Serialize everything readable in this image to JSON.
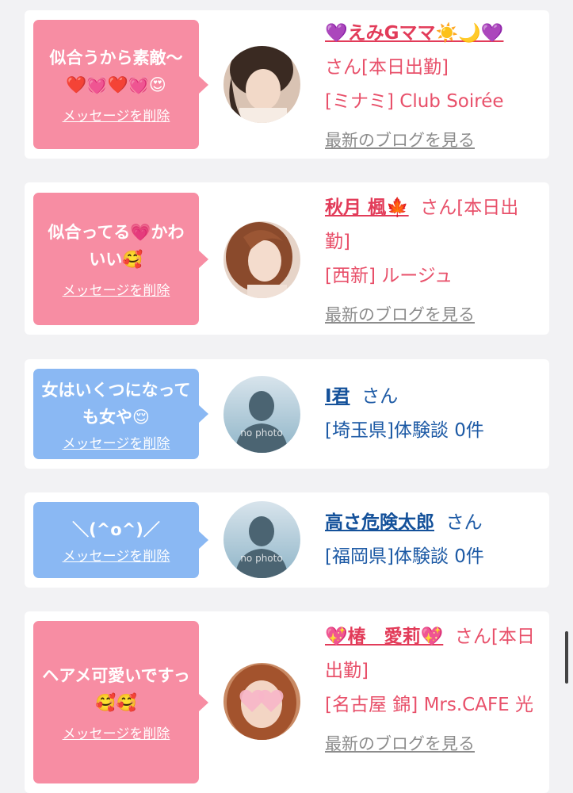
{
  "delete_label": "メッセージを削除",
  "blog_label": "最新のブログを見る",
  "no_photo": "no photo",
  "colors": {
    "pink_bubble": "#f78da3",
    "blue_bubble": "#8ab8f3",
    "pink_text": "#e8506a",
    "blue_text": "#1d5aa5"
  },
  "items": [
    {
      "message": "似合うから素敵〜❤️💓❤️💓😍",
      "name": "💜えみGママ☀️🌙💜",
      "suffix": "さん[本日出勤]",
      "shop": "[ミナミ] Club Soirée",
      "has_blog": true,
      "avatar": "photo-woman-1"
    },
    {
      "message": "似合ってる💗かわいい🥰",
      "name": "秋月 楓🍁",
      "suffix": "さん[本日出勤]",
      "shop": "[西新] ルージュ",
      "has_blog": true,
      "avatar": "photo-woman-2"
    },
    {
      "message": "女はいくつになっても女や😌",
      "name": "I君",
      "suffix": "さん",
      "shop": "[埼玉県]体験談 0件",
      "has_blog": false,
      "avatar": "no-photo"
    },
    {
      "message": "＼(^o^)／",
      "name": "高さ危険太郎",
      "suffix": "さん",
      "shop": "[福岡県]体験談 0件",
      "has_blog": false,
      "avatar": "no-photo"
    },
    {
      "message": "ヘアメ可愛いですっ🥰🥰",
      "name": "💖椿　愛莉💖",
      "suffix": "さん[本日出勤]",
      "shop": "[名古屋 錦] Mrs.CAFE 光",
      "has_blog": true,
      "avatar": "photo-woman-3"
    }
  ]
}
